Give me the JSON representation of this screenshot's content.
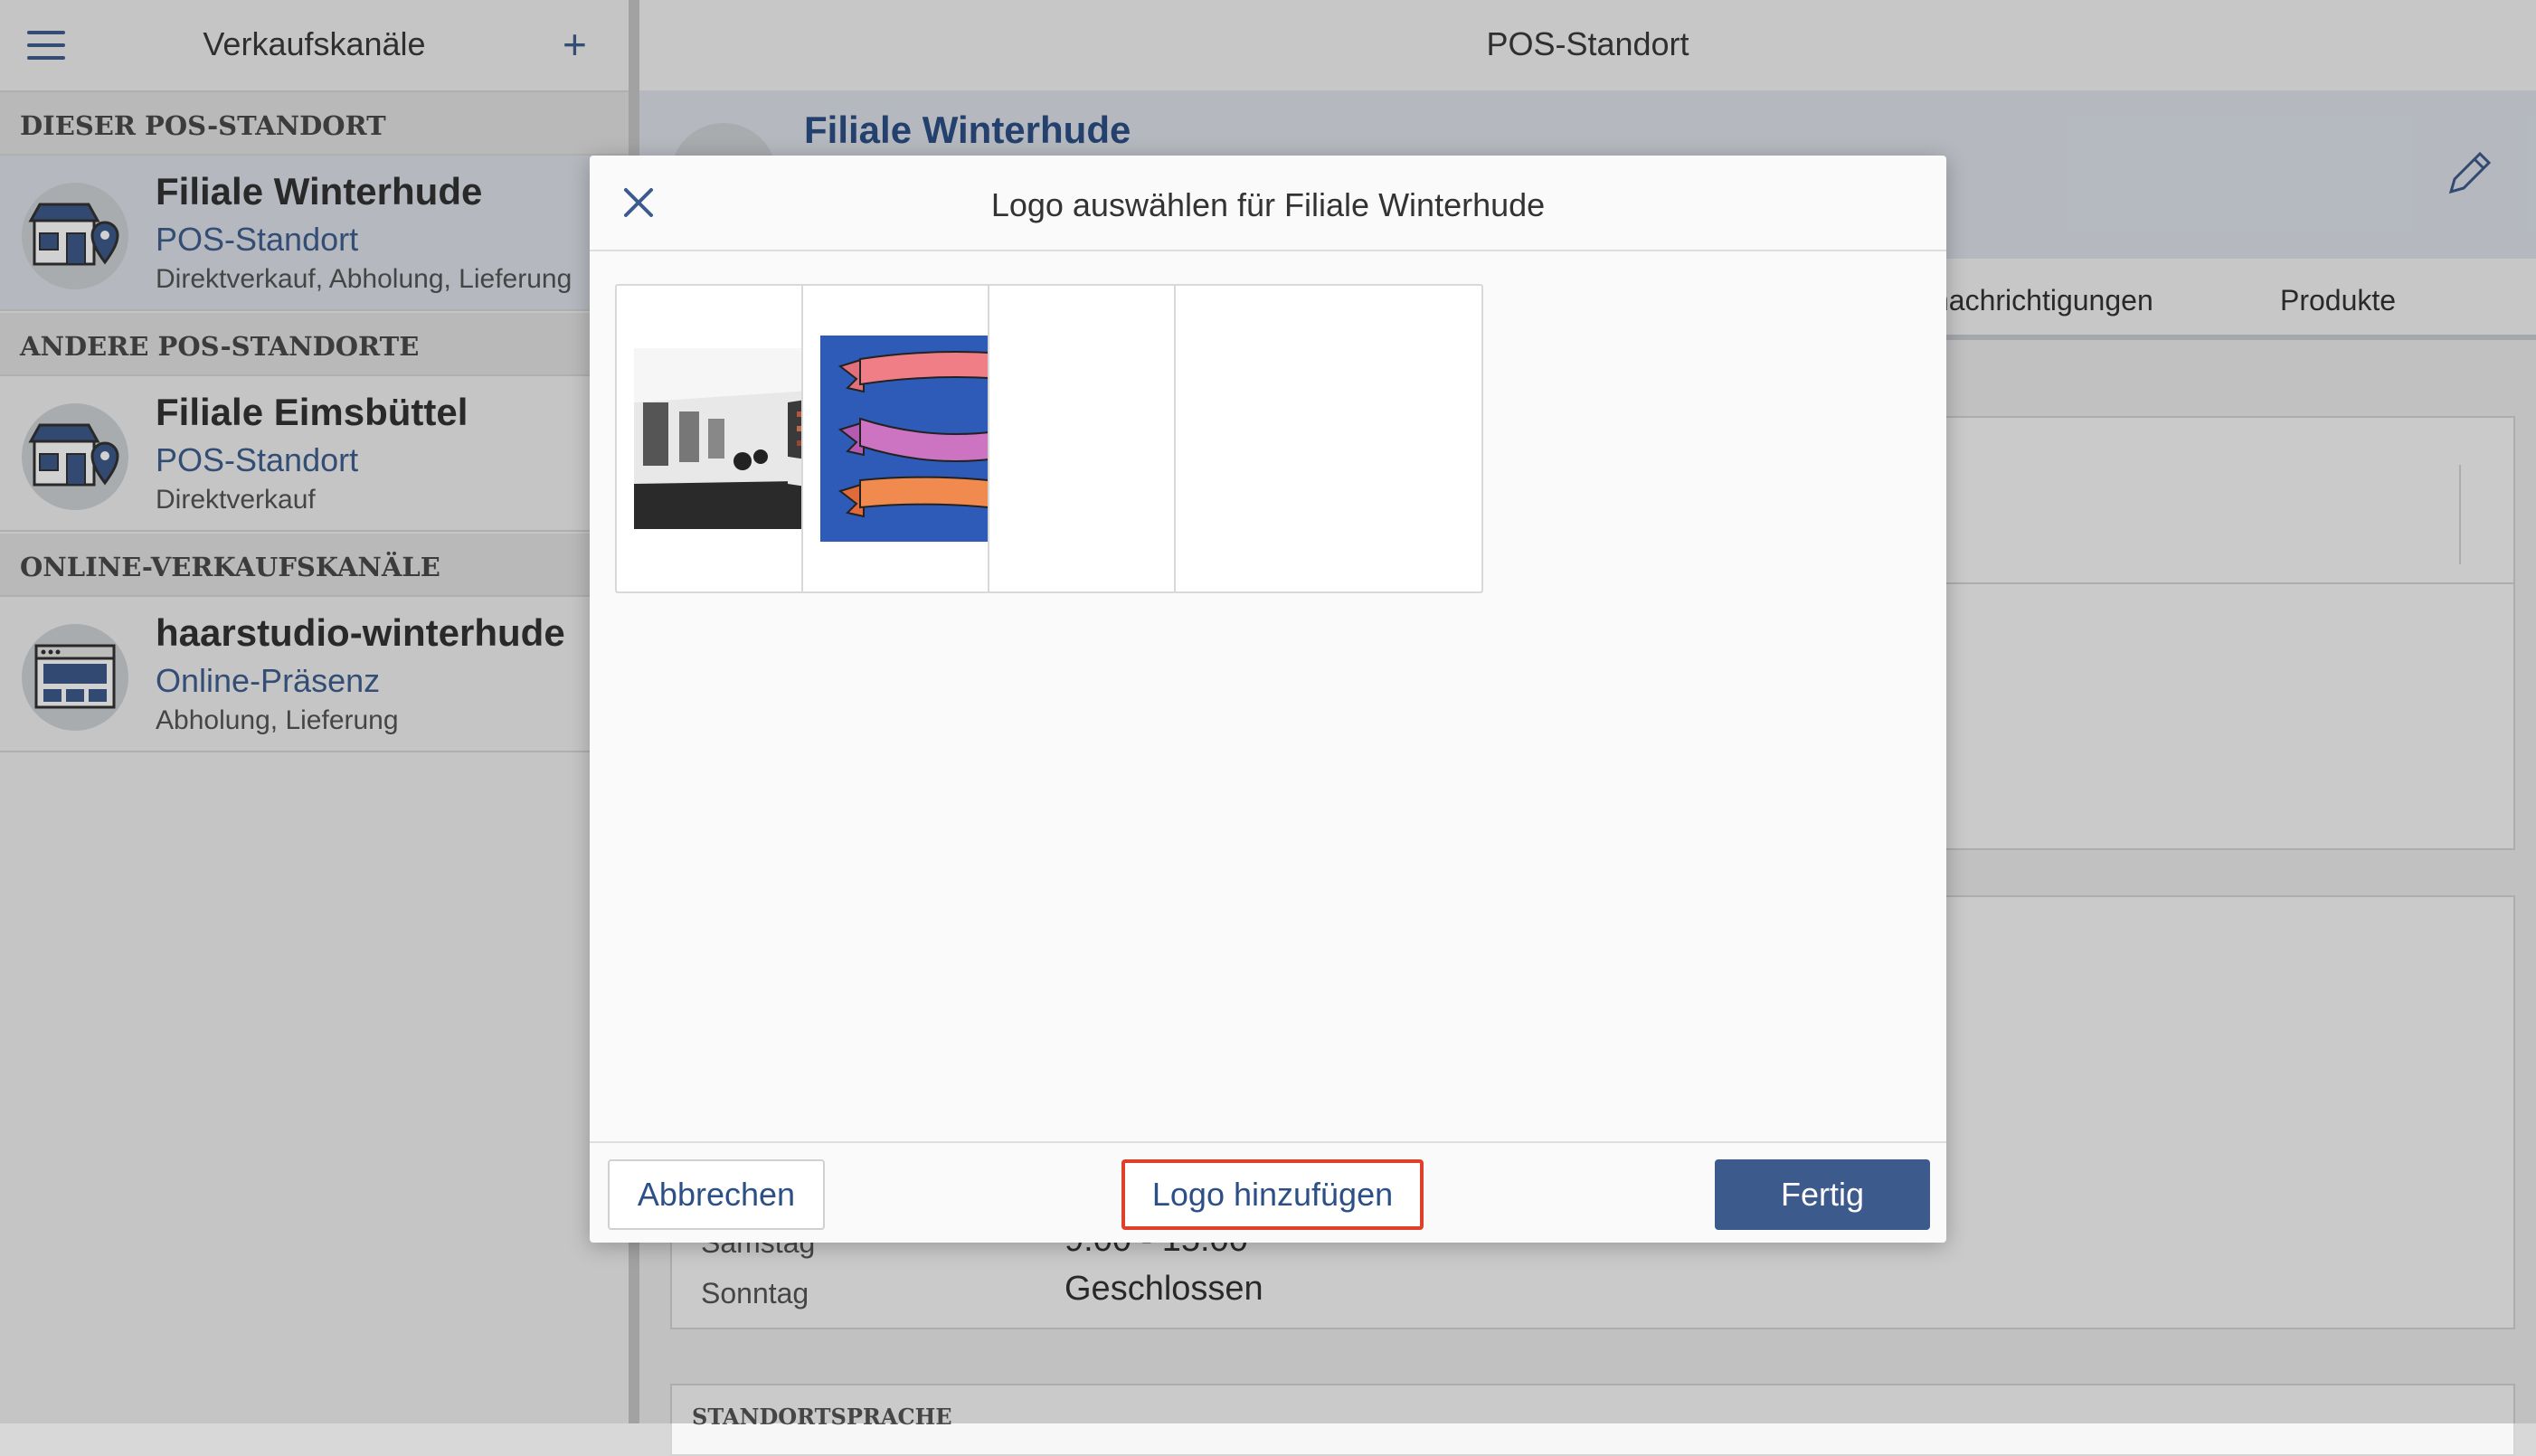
{
  "sidebar": {
    "title": "Verkaufskanäle",
    "sections": [
      {
        "label": "DIESER POS-STANDORT"
      },
      {
        "label": "ANDERE POS-STANDORTE"
      },
      {
        "label": "ONLINE-VERKAUFSKANÄLE"
      }
    ],
    "items": [
      {
        "title": "Filiale Winterhude",
        "subtitle": "POS-Standort",
        "desc": "Direktverkauf, Abholung, Lieferung",
        "icon": "store-location-icon"
      },
      {
        "title": "Filiale Eimsbüttel",
        "subtitle": "POS-Standort",
        "desc": "Direktverkauf",
        "icon": "store-location-icon"
      },
      {
        "title": "haarstudio-winterhude",
        "subtitle": "Online-Präsenz",
        "desc": "Abholung, Lieferung",
        "icon": "browser-window-icon"
      }
    ]
  },
  "main": {
    "title": "POS-Standort",
    "detail_name": "Filiale Winterhude",
    "tabs": [
      {
        "label": "nachrichtigungen"
      },
      {
        "label": "Produkte"
      }
    ],
    "hours": [
      {
        "day": "Samstag",
        "time": "9:00 - 15:00"
      },
      {
        "day": "Sonntag",
        "time": "Geschlossen"
      }
    ],
    "next_section": "STANDORTSPRACHE"
  },
  "modal": {
    "title": "Logo auswählen für Filiale Winterhude",
    "cancel_label": "Abbrechen",
    "add_label": "Logo hinzufügen",
    "done_label": "Fertig",
    "tiles": [
      {
        "content": "salon-interior-photo"
      },
      {
        "content": "ribbon-banners-drawing"
      },
      {
        "content": "empty"
      },
      {
        "content": "empty"
      }
    ]
  },
  "colors": {
    "accent": "#3d5a8c",
    "highlight": "#e0402a"
  }
}
